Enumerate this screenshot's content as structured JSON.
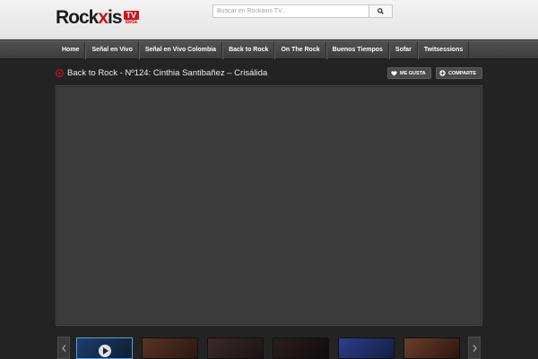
{
  "header": {
    "logo": {
      "word_start": "Rock",
      "word_x": "x",
      "word_end": "is",
      "tv": "TV",
      "beta": "Beta"
    },
    "search": {
      "placeholder": "Buscar en Rockaxis TV..."
    }
  },
  "nav": {
    "items": [
      {
        "label": "Home"
      },
      {
        "label": "Señal en Vivo"
      },
      {
        "label": "Señal en Vivo Colombia"
      },
      {
        "label": "Back to Rock"
      },
      {
        "label": "On The Rock"
      },
      {
        "label": "Buenos Tiempos"
      },
      {
        "label": "Sofar"
      },
      {
        "label": "Twitsessions"
      }
    ]
  },
  "video": {
    "title": "Back to Rock - Nº124: Cinthia Santibañez – Crisálida",
    "like_label": "ME GUSTA",
    "share_label": "COMPARTE"
  },
  "carousel": {
    "thumbnails": [
      {
        "color_a": "#1c3f6b",
        "color_b": "#0e1c33",
        "active": true
      },
      {
        "color_a": "#5a3322",
        "color_b": "#2a1810",
        "active": false
      },
      {
        "color_a": "#3a2a28",
        "color_b": "#1b1414",
        "active": false
      },
      {
        "color_a": "#2b1e1e",
        "color_b": "#120c0c",
        "active": false
      },
      {
        "color_a": "#2b3f8a",
        "color_b": "#141e45",
        "active": false
      },
      {
        "color_a": "#6b3e2a",
        "color_b": "#2c170e",
        "active": false
      }
    ]
  },
  "colors": {
    "brand_red": "#d0101a",
    "nav_bg": "#454545",
    "page_bg": "#232323",
    "player_bg": "#3b3b3b"
  }
}
